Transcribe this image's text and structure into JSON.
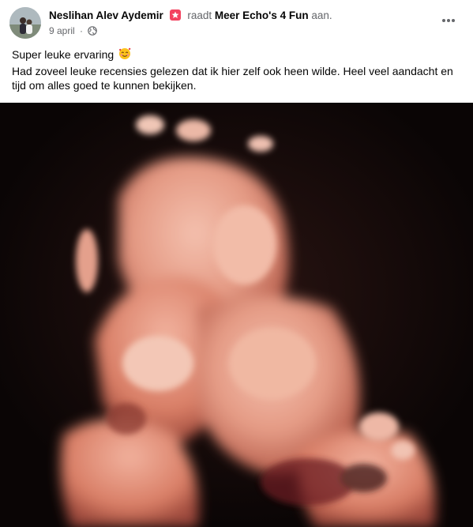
{
  "post": {
    "author_name": "Neslihan Alev Aydemir",
    "action_verb": "raadt",
    "page_name": "Meer Echo's 4 Fun",
    "action_suffix": "aan.",
    "date": "9 april",
    "separator": "·",
    "privacy_icon": "globe-icon",
    "badge_icon": "star-badge-icon",
    "more_icon": "more-horizontal-icon",
    "emoji_icon": "smiling-face-with-hearts-emoji",
    "text_line_1": "Super leuke ervaring",
    "text_line_2": "Had zoveel leuke recensies gelezen dat ik hier zelf ook heen wilde. Heel veel aandacht en tijd om alles goed te kunnen bekijken."
  },
  "colors": {
    "badge": "#f3425f",
    "meta_text": "#65676b",
    "photo_background": "#0d0707",
    "photo_skin": "#e8a088"
  }
}
